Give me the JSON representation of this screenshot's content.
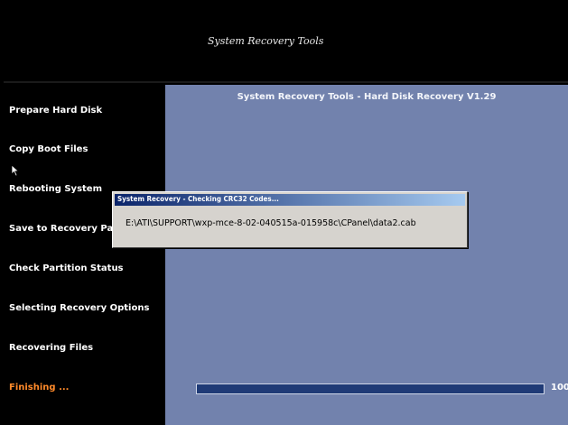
{
  "header": {
    "title": "System Recovery Tools"
  },
  "sidebar": {
    "steps": [
      {
        "label": "Prepare Hard Disk",
        "active": false
      },
      {
        "label": "Copy Boot Files",
        "active": false
      },
      {
        "label": "Rebooting System",
        "active": false
      },
      {
        "label": "Save to Recovery Par",
        "active": false
      },
      {
        "label": "Check Partition Status",
        "active": false
      },
      {
        "label": "Selecting Recovery Options",
        "active": false
      },
      {
        "label": "Recovering Files",
        "active": false
      },
      {
        "label": "Finishing ...",
        "active": true
      }
    ]
  },
  "main": {
    "title": "System Recovery Tools - Hard Disk Recovery V1.29"
  },
  "progress": {
    "value_percent": 100,
    "label": "100"
  },
  "dialog": {
    "title": "System Recovery - Checking CRC32 Codes...",
    "file_path": "E:\\ATI\\SUPPORT\\wxp-mce-8-02-040515a-015958c\\CPanel\\data2.cab"
  },
  "colors": {
    "background": "#000000",
    "panel": "#7282ad",
    "active_step": "#ff8a2a",
    "progress_fill": "#1f3a76"
  }
}
